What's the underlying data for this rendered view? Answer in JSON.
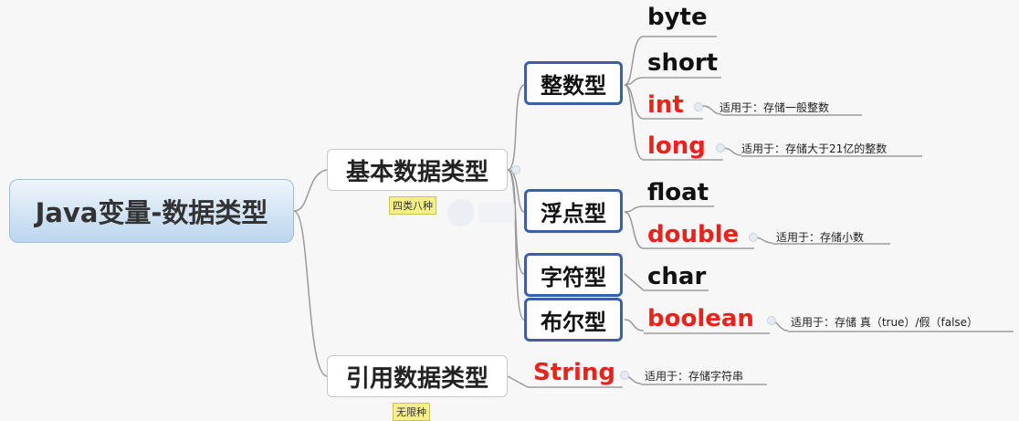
{
  "root": {
    "title": "Java变量-数据类型"
  },
  "primitive": {
    "label": "基本数据类型",
    "tag": "四类八种",
    "integer": {
      "label": "整数型",
      "items": {
        "byte": "byte",
        "short": "short",
        "int": "int",
        "int_note": "适用于：存储一般整数",
        "long": "long",
        "long_note": "适用于：存储大于21亿的整数"
      }
    },
    "float_cat": {
      "label": "浮点型",
      "items": {
        "float": "float",
        "double": "double",
        "double_note": "适用于：存储小数"
      }
    },
    "char_cat": {
      "label": "字符型",
      "items": {
        "char": "char"
      }
    },
    "bool_cat": {
      "label": "布尔型",
      "items": {
        "boolean": "boolean",
        "boolean_note": "适用于：存储 真（true）/假（false）"
      }
    }
  },
  "reference": {
    "label": "引用数据类型",
    "tag": "无限种",
    "string": "String",
    "string_note": "适用于：存储字符串"
  },
  "colors": {
    "highlight": "#e8231b",
    "category_border": "#3b5fa8",
    "root_fill": "#bcd6ee",
    "tag_fill": "#f6f08a"
  }
}
